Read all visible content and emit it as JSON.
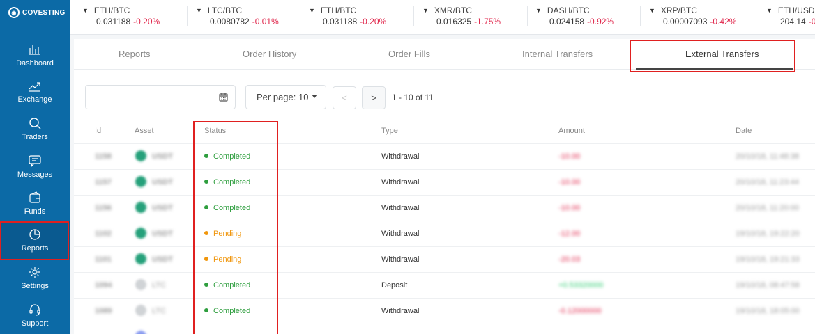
{
  "brand": {
    "name": "COVESTING"
  },
  "sidebar": {
    "items": [
      {
        "label": "Dashboard",
        "icon": "dashboard-icon"
      },
      {
        "label": "Exchange",
        "icon": "chart-line-icon"
      },
      {
        "label": "Traders",
        "icon": "search-icon"
      },
      {
        "label": "Messages",
        "icon": "chat-icon"
      },
      {
        "label": "Funds",
        "icon": "wallet-icon"
      },
      {
        "label": "Reports",
        "icon": "pie-chart-icon"
      },
      {
        "label": "Settings",
        "icon": "gear-icon"
      },
      {
        "label": "Support",
        "icon": "headset-icon"
      }
    ]
  },
  "ticker": [
    {
      "pair": "ETH/BTC",
      "price": "0.031188",
      "change": "-0.20%"
    },
    {
      "pair": "LTC/BTC",
      "price": "0.0080782",
      "change": "-0.01%"
    },
    {
      "pair": "ETH/BTC",
      "price": "0.031188",
      "change": "-0.20%"
    },
    {
      "pair": "XMR/BTC",
      "price": "0.016325",
      "change": "-1.75%"
    },
    {
      "pair": "DASH/BTC",
      "price": "0.024158",
      "change": "-0.92%"
    },
    {
      "pair": "XRP/BTC",
      "price": "0.00007093",
      "change": "-0.42%"
    },
    {
      "pair": "ETH/USD",
      "price": "204.14",
      "change": "-0"
    }
  ],
  "tabs": [
    "Reports",
    "Order History",
    "Order Fills",
    "Internal Transfers",
    "External Transfers"
  ],
  "controls": {
    "date_placeholder": "",
    "per_page_label": "Per page: 10",
    "prev": "<",
    "next": ">",
    "page_info": "1 - 10 of 11"
  },
  "table": {
    "headers": [
      "Id",
      "Asset",
      "Status",
      "Type",
      "Amount",
      "Date"
    ],
    "rows": [
      {
        "id": "1158",
        "asset": "USDT",
        "status": "Completed",
        "type": "Withdrawal",
        "amount": "-10.00",
        "date": "20/10/18, 11:48:38"
      },
      {
        "id": "1157",
        "asset": "USDT",
        "status": "Completed",
        "type": "Withdrawal",
        "amount": "-10.00",
        "date": "20/10/18, 11:23:44"
      },
      {
        "id": "1156",
        "asset": "USDT",
        "status": "Completed",
        "type": "Withdrawal",
        "amount": "-10.00",
        "date": "20/10/18, 11:20:00"
      },
      {
        "id": "1102",
        "asset": "USDT",
        "status": "Pending",
        "type": "Withdrawal",
        "amount": "-12.00",
        "date": "19/10/18, 19:22:20"
      },
      {
        "id": "1101",
        "asset": "USDT",
        "status": "Pending",
        "type": "Withdrawal",
        "amount": "-20.03",
        "date": "19/10/18, 19:21:33"
      },
      {
        "id": "1094",
        "asset": "LTC",
        "status": "Completed",
        "type": "Deposit",
        "amount": "+0.53320000",
        "date": "19/10/18, 08:47:58"
      },
      {
        "id": "1089",
        "asset": "LTC",
        "status": "Completed",
        "type": "Withdrawal",
        "amount": "-0.12000000",
        "date": "19/10/18, 18:05:00"
      }
    ]
  },
  "colors": {
    "sidebar_bg": "#0c6aa6",
    "completed": "#2e9e3e",
    "pending": "#f0960c",
    "negative": "#e0264b",
    "positive": "#2ecc71",
    "highlight": "#e02020"
  }
}
